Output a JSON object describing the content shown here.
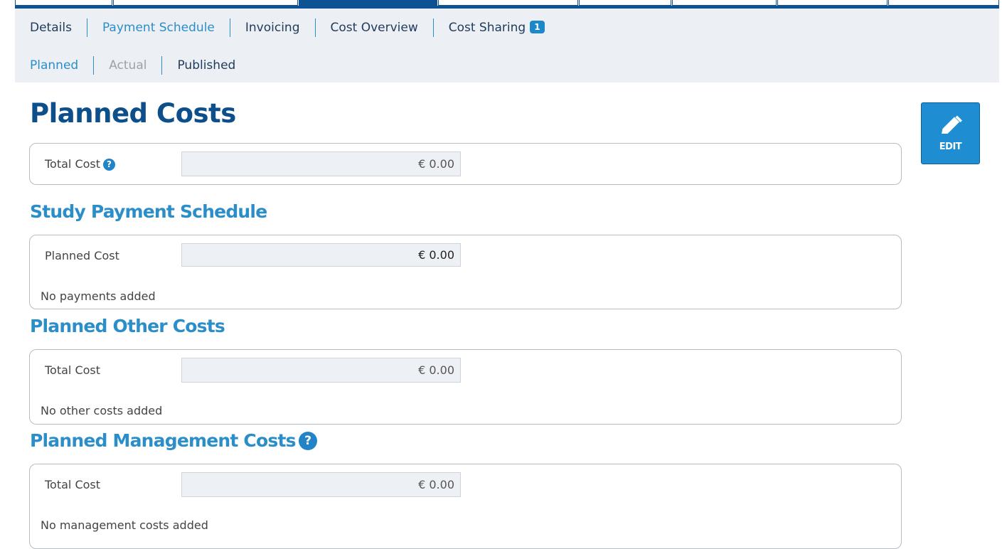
{
  "tabs": [
    {
      "label": "Details",
      "state": "normal"
    },
    {
      "label": "Payment Schedule",
      "state": "active"
    },
    {
      "label": "Invoicing",
      "state": "normal"
    },
    {
      "label": "Cost Overview",
      "state": "normal"
    },
    {
      "label": "Cost Sharing",
      "state": "normal",
      "badge": "1"
    }
  ],
  "subtabs": [
    {
      "label": "Planned",
      "state": "active"
    },
    {
      "label": "Actual",
      "state": "disabled"
    },
    {
      "label": "Published",
      "state": "normal"
    }
  ],
  "page": {
    "title": "Planned Costs",
    "edit_label": "EDIT",
    "edit_icon": "pencil-icon",
    "help_icon": "question-mark-icon"
  },
  "total_cost": {
    "label": "Total Cost",
    "value": "€ 0.00"
  },
  "study_payment": {
    "title": "Study Payment Schedule",
    "label": "Planned Cost",
    "value": "€ 0.00",
    "empty": "No payments added"
  },
  "other_costs": {
    "title": "Planned Other Costs",
    "label": "Total Cost",
    "value": "€ 0.00",
    "empty": "No other costs added"
  },
  "management_costs": {
    "title": "Planned Management Costs",
    "label": "Total Cost",
    "value": "€ 0.00",
    "empty": "No management costs added"
  },
  "colors": {
    "primary": "#0d5393",
    "accent": "#2b8ec9",
    "button": "#1e8dd2",
    "nav_bg": "#ecf0f5"
  }
}
